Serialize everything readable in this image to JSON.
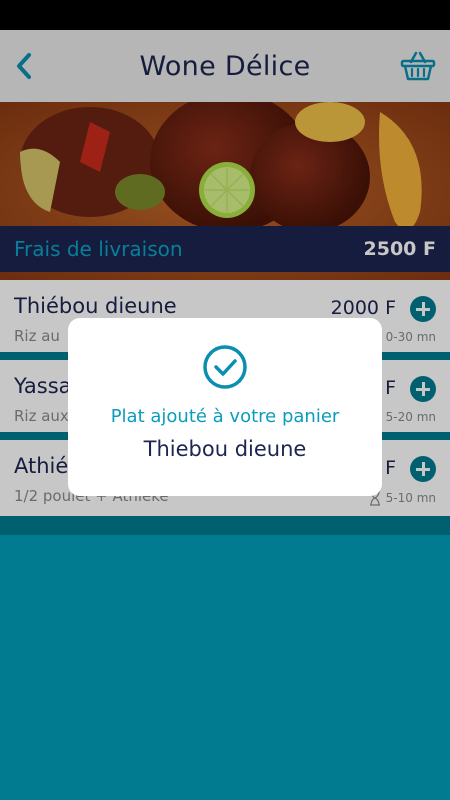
{
  "header": {
    "title": "Wone Délice"
  },
  "delivery": {
    "label": "Frais de livraison",
    "value": "2500 F"
  },
  "menu": [
    {
      "name": "Thiébou dieune",
      "desc": "Riz au",
      "price": "2000 F",
      "time": "0-30 mn"
    },
    {
      "name": "Yassa",
      "desc": "Riz aux",
      "price": "F",
      "time": "5-20 mn"
    },
    {
      "name": "Athié",
      "desc": "1/2 poulet + Athiéké",
      "price": "F",
      "time": "5-10 mn"
    }
  ],
  "modal": {
    "message": "Plat ajouté à votre panier",
    "item": "Thiebou dieune"
  },
  "colors": {
    "primary": "#007b8f",
    "navy": "#1d2550",
    "accent": "#0aa3c5"
  }
}
